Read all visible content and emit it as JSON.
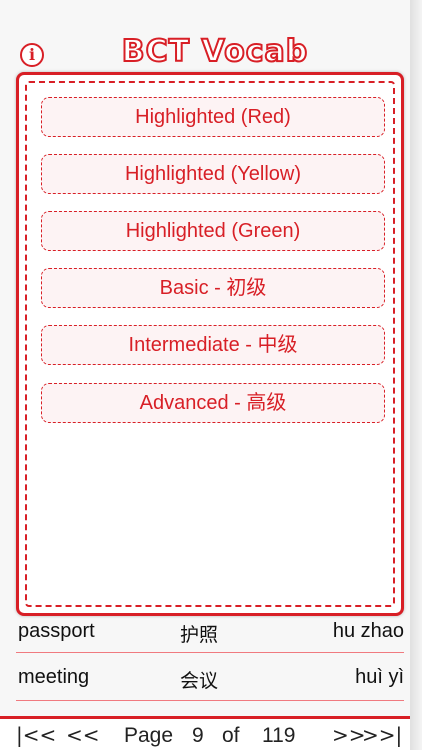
{
  "header": {
    "title": "BCT Vocab",
    "info_glyph": "i",
    "accent_color": "#d81f26"
  },
  "filter_menu": {
    "options": [
      {
        "label": "Highlighted (Red)"
      },
      {
        "label": "Highlighted (Yellow)"
      },
      {
        "label": "Highlighted (Green)"
      },
      {
        "label": "Basic  -  初级"
      },
      {
        "label": "Intermediate  -  中级"
      },
      {
        "label": "Advanced  -  高级"
      }
    ]
  },
  "vocab_list": {
    "rows": [
      {
        "english": "passport",
        "chinese": "护照",
        "pinyin": "hu zhao"
      },
      {
        "english": "meeting",
        "chinese": "会议",
        "pinyin": "huì yì"
      }
    ]
  },
  "pagination": {
    "first_glyph": "|<<",
    "prev_glyph": "<<",
    "page_label": "Page",
    "current_page": "9",
    "of_label": "of",
    "total_pages": "119",
    "next_glyph": ">>",
    "last_glyph": ">>|"
  }
}
